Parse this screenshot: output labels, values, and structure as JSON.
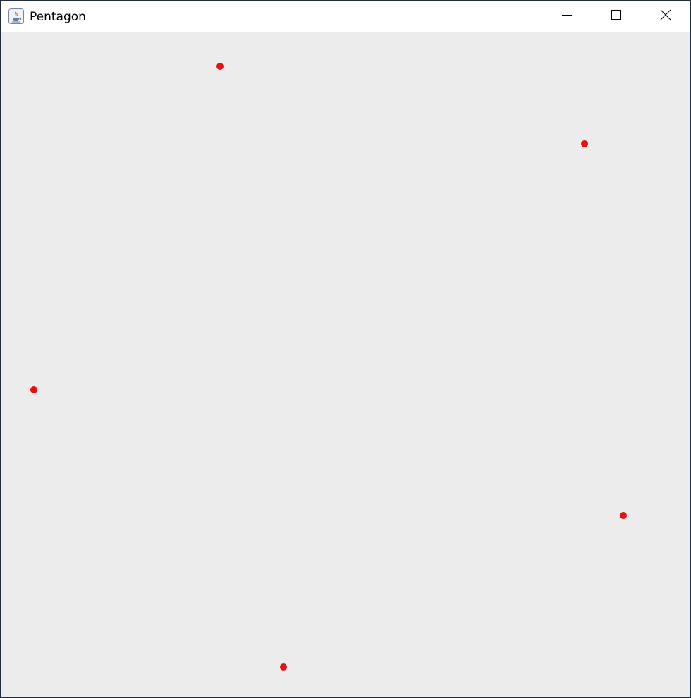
{
  "window": {
    "title": "Pentagon",
    "icon": "java-coffee-icon"
  },
  "controls": {
    "minimize_icon": "minimize-icon",
    "maximize_icon": "maximize-icon",
    "close_icon": "close-icon"
  },
  "canvas": {
    "background": "#ececec",
    "point_color": "#e81010",
    "point_count": 5
  }
}
